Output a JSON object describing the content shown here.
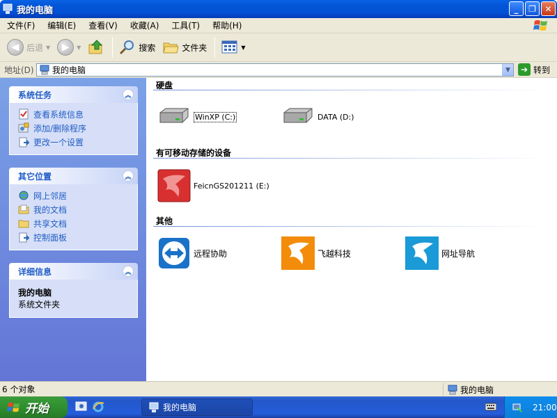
{
  "window": {
    "title": "我的电脑",
    "buttons": {
      "minimize": "_",
      "restore": "❐",
      "close": "✕"
    }
  },
  "menubar": {
    "items": [
      "文件(F)",
      "编辑(E)",
      "查看(V)",
      "收藏(A)",
      "工具(T)",
      "帮助(H)"
    ]
  },
  "toolbar": {
    "back": "后退",
    "search": "搜索",
    "folders": "文件夹"
  },
  "address": {
    "label": "地址(D)",
    "value": "我的电脑",
    "go": "转到"
  },
  "sidebar": {
    "system_tasks": {
      "title": "系统任务",
      "items": [
        "查看系统信息",
        "添加/删除程序",
        "更改一个设置"
      ]
    },
    "other_places": {
      "title": "其它位置",
      "items": [
        "网上邻居",
        "我的文档",
        "共享文档",
        "控制面板"
      ]
    },
    "details": {
      "title": "详细信息",
      "name": "我的电脑",
      "type": "系统文件夹"
    }
  },
  "content": {
    "groups": [
      {
        "title": "硬盘",
        "items": [
          "WinXP (C:)",
          "DATA (D:)"
        ]
      },
      {
        "title": "有可移动存储的设备",
        "items": [
          "FeicnGS201211 (E:)"
        ]
      },
      {
        "title": "其他",
        "items": [
          "远程协助",
          "飞越科技",
          "网址导航"
        ]
      }
    ]
  },
  "statusbar": {
    "count": "6 个对象",
    "location": "我的电脑"
  },
  "taskbar": {
    "start": "开始",
    "task": "我的电脑",
    "clock": "21:00"
  },
  "colors": {
    "titlebar": "#0356d6",
    "sidebar_link": "#215dc6",
    "start_green": "#2f8f2f",
    "tray_blue": "#0f8ded"
  }
}
